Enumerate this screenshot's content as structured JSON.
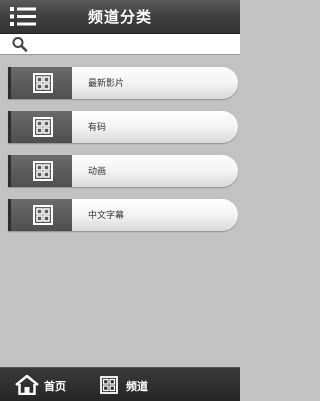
{
  "header": {
    "title": "频道分类",
    "menu_icon": "menu-list-icon"
  },
  "search": {
    "icon": "search-icon",
    "placeholder": "",
    "value": ""
  },
  "channels": [
    {
      "label": "最新影片",
      "icon": "grid-icon"
    },
    {
      "label": "有码",
      "icon": "grid-icon"
    },
    {
      "label": "动画",
      "icon": "grid-icon"
    },
    {
      "label": "中文字幕",
      "icon": "grid-icon"
    }
  ],
  "footer": {
    "tabs": [
      {
        "label": "首页",
        "icon": "home-icon"
      },
      {
        "label": "频道",
        "icon": "grid-icon"
      }
    ]
  },
  "colors": {
    "header_bg": "#3e3e3e",
    "content_bg": "#c2c2c2",
    "item_bg": "#f3f3f3",
    "icon_box_bg": "#4f4f4f",
    "footer_bg": "#262626"
  }
}
